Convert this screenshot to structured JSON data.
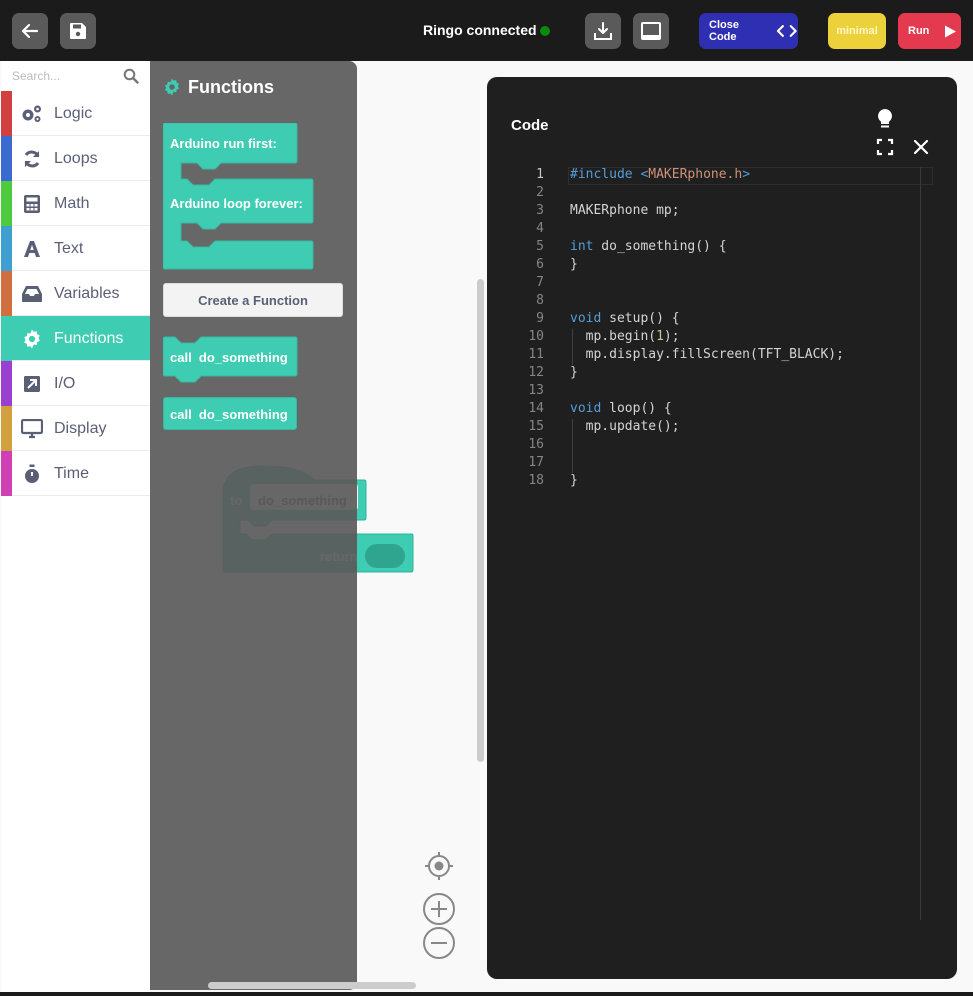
{
  "topbar": {
    "back_icon": "arrow-left-icon",
    "save_icon": "floppy-disk-icon",
    "connection_status": "Ringo connected",
    "connection_color": "#0a8a0a",
    "download_icon": "download-icon",
    "console_icon": "console-panel-icon",
    "close_code_label": "Close Code",
    "close_code_icon": "code-brackets-icon",
    "minimal_label": "minimal",
    "run_label": "Run",
    "run_icon": "play-icon"
  },
  "toolbox": {
    "search_placeholder": "Search...",
    "categories": [
      {
        "label": "Logic",
        "icon": "gears-icon",
        "color": "#d13f3f"
      },
      {
        "label": "Loops",
        "icon": "sync-icon",
        "color": "#3b6bd1"
      },
      {
        "label": "Math",
        "icon": "calculator-icon",
        "color": "#4ecb3d"
      },
      {
        "label": "Text",
        "icon": "font-icon",
        "color": "#3f9fd1"
      },
      {
        "label": "Variables",
        "icon": "inbox-icon",
        "color": "#d1703f"
      },
      {
        "label": "Functions",
        "icon": "gear-icon",
        "color": "#3ecdb3",
        "selected": true
      },
      {
        "label": "I/O",
        "icon": "external-link-icon",
        "color": "#9b3fd1"
      },
      {
        "label": "Display",
        "icon": "monitor-icon",
        "color": "#d1a03f"
      },
      {
        "label": "Time",
        "icon": "stopwatch-icon",
        "color": "#d13fb5"
      }
    ]
  },
  "flyout": {
    "title": "Functions",
    "blocks": {
      "run_first": "Arduino run first:",
      "loop_forever": "Arduino loop forever:",
      "create_function": "Create a Function",
      "call_statement": "call  do_something",
      "call_value": "call  do_something"
    }
  },
  "workspace": {
    "def_block_to": "to",
    "def_block_name": "do_something",
    "def_block_return": "return"
  },
  "code_panel": {
    "title": "Code",
    "lightbulb_icon": "lightbulb-icon",
    "fullscreen_icon": "fullscreen-icon",
    "close_icon": "close-icon",
    "lines": [
      "#include <MAKERphone.h>",
      "",
      "MAKERphone mp;",
      "",
      "int do_something() {",
      "}",
      "",
      "",
      "void setup() {",
      "  mp.begin(1);",
      "  mp.display.fillScreen(TFT_BLACK);",
      "}",
      "",
      "void loop() {",
      "  mp.update();",
      "",
      "",
      "}"
    ],
    "active_line": 1
  }
}
